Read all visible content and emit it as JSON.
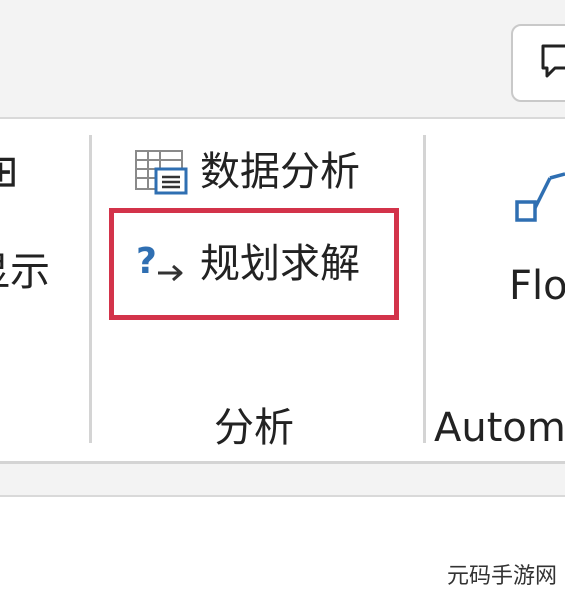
{
  "ribbon": {
    "left_group": {
      "glyph": "⊞",
      "label": "显示"
    },
    "analysis_group": {
      "data_analysis_label": "数据分析",
      "solver_label": "规划求解",
      "group_label": "分析"
    },
    "automate_group": {
      "flow_label": "Flo",
      "group_label": "Autom"
    }
  },
  "toolbar": {
    "comment_icon": "comment-icon"
  },
  "highlight": {
    "color": "#d3334a"
  },
  "watermark": "元码手游网"
}
